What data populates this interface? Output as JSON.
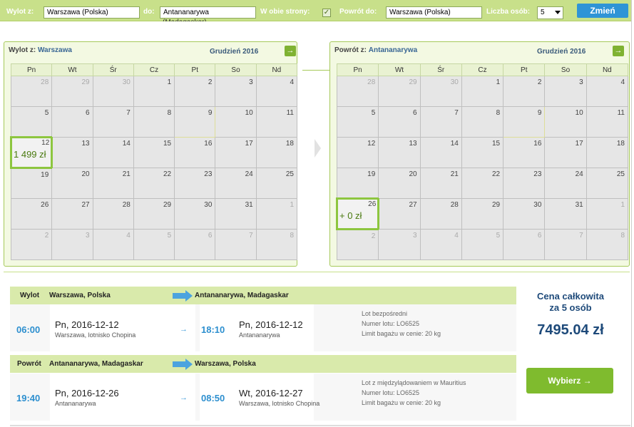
{
  "search": {
    "from_label": "Wylot z:",
    "from_value": "Warszawa (Polska)",
    "to_label": "do:",
    "to_value": "Antananarywa",
    "to_overflow": "(Madagaskar)",
    "round_trip_label": "W obie strony:",
    "round_trip_checked": "✓",
    "return_label": "Powrót do:",
    "return_value": "Warszawa (Polska)",
    "persons_label": "Liczba osób:",
    "persons_value": "5",
    "change_button": "Zmień"
  },
  "weekdays": [
    "Pn",
    "Wt",
    "Śr",
    "Cz",
    "Pt",
    "So",
    "Nd"
  ],
  "outbound_calendar": {
    "label": "Wylot z:",
    "city": "Warszawa",
    "month": "Grudzień 2016",
    "nav_icon": "→",
    "weeks": [
      [
        "28",
        "29",
        "30",
        "1",
        "2",
        "3",
        "4"
      ],
      [
        "5",
        "6",
        "7",
        "8",
        "9",
        "10",
        "11"
      ],
      [
        "12",
        "13",
        "14",
        "15",
        "16",
        "17",
        "18"
      ],
      [
        "19",
        "20",
        "21",
        "22",
        "23",
        "24",
        "25"
      ],
      [
        "26",
        "27",
        "28",
        "29",
        "30",
        "31",
        "1"
      ],
      [
        "2",
        "3",
        "4",
        "5",
        "6",
        "7",
        "8"
      ]
    ],
    "selected_price": "1 499 zł"
  },
  "return_calendar": {
    "label": "Powrót z:",
    "city": "Antananarywa",
    "month": "Grudzień 2016",
    "nav_icon": "→",
    "weeks": [
      [
        "28",
        "29",
        "30",
        "1",
        "2",
        "3",
        "4"
      ],
      [
        "5",
        "6",
        "7",
        "8",
        "9",
        "10",
        "11"
      ],
      [
        "12",
        "13",
        "14",
        "15",
        "16",
        "17",
        "18"
      ],
      [
        "19",
        "20",
        "21",
        "22",
        "23",
        "24",
        "25"
      ],
      [
        "26",
        "27",
        "28",
        "29",
        "30",
        "31",
        "1"
      ],
      [
        "2",
        "3",
        "4",
        "5",
        "6",
        "7",
        "8"
      ]
    ],
    "selected_price": "+ 0 zł"
  },
  "outbound": {
    "label": "Wylot",
    "origin": "Warszawa, Polska",
    "destination": "Antananarywa, Madagaskar",
    "dep_time": "06:00",
    "dep_day": "Pn",
    "dep_date": "2016-12-12",
    "dep_airport": "Warszawa, lotnisko Chopina",
    "arr_time": "18:10",
    "arr_day": "Pn",
    "arr_date": "2016-12-12",
    "arr_airport": "Antananarywa",
    "info1": "Lot bezpośredni",
    "info2": "Numer lotu: LO6525",
    "info3": "Limit bagażu w cenie: 20 kg"
  },
  "inbound": {
    "label": "Powrót",
    "origin": "Antananarywa, Madagaskar",
    "destination": "Warszawa, Polska",
    "dep_time": "19:40",
    "dep_day": "Pn",
    "dep_date": "2016-12-26",
    "dep_airport": "Antananarywa",
    "arr_time": "08:50",
    "arr_day": "Wt",
    "arr_date": "2016-12-27",
    "arr_airport": "Warszawa, lotnisko Chopina",
    "info1": "Lot z międzylądowaniem w Mauritius",
    "info2": "Numer lotu: LO6525",
    "info3": "Limit bagażu w cenie: 20 kg"
  },
  "price": {
    "label_line1": "Cena całkowita",
    "label_line2": "za 5 osób",
    "total": "7495.04 zł",
    "choose_button": "Wybierz",
    "choose_icon": "→"
  },
  "colors": {
    "accent_green": "#8dc63f",
    "accent_blue": "#2f94d6",
    "time_blue": "#2d8fcf"
  }
}
